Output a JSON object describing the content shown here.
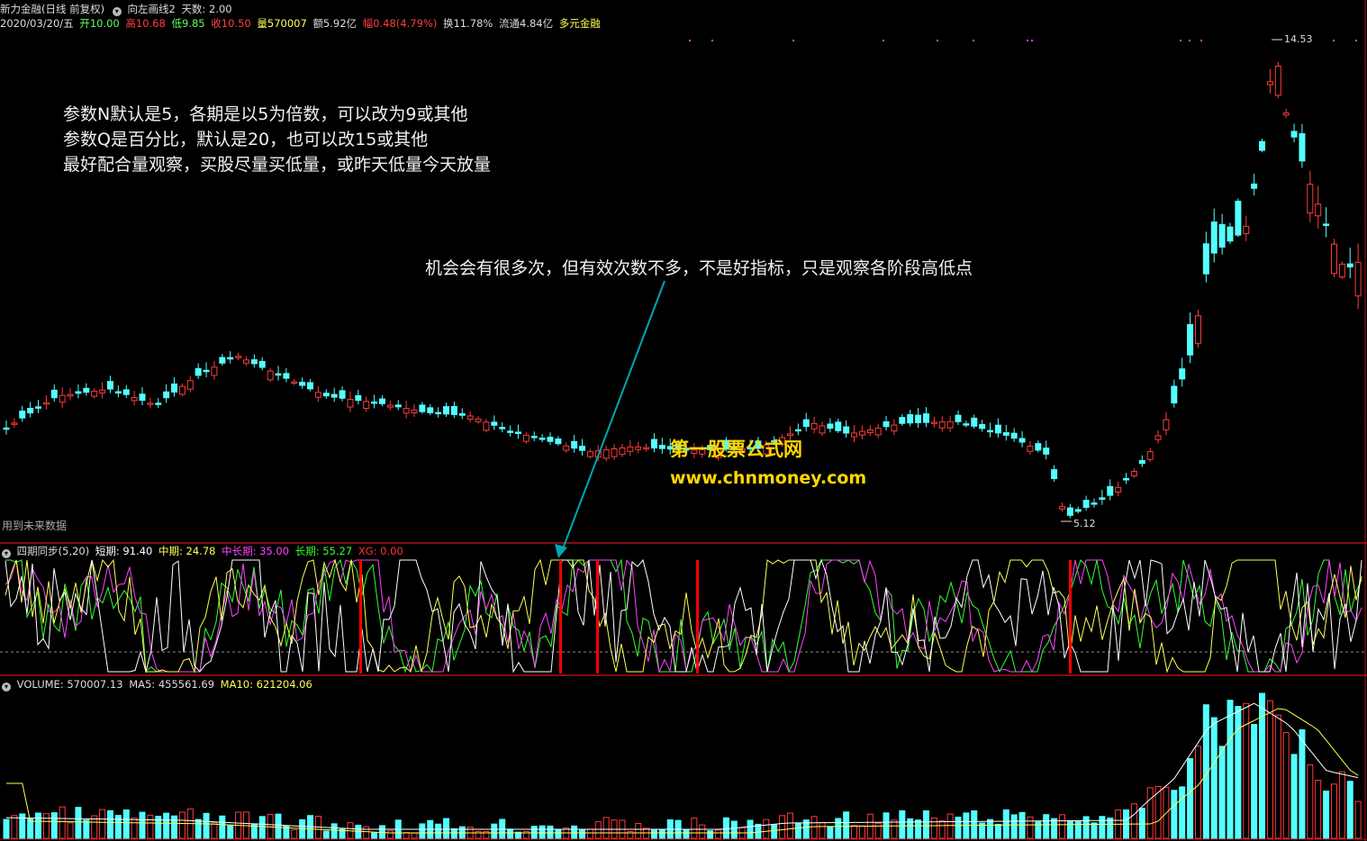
{
  "header": {
    "stock_name": "新力金融(日线 前复权)",
    "formula_name": "向左画线2",
    "days_label": "天数: 2.00"
  },
  "quote": {
    "date": "2020/03/20/五",
    "open": "开10.00",
    "high": "高10.68",
    "low": "低9.85",
    "close": "收10.50",
    "volume": "量570007",
    "amount": "额5.92亿",
    "change": "幅0.48(4.79%)",
    "turnover": "换11.78%",
    "float": "流通4.84亿",
    "sector": "多元金融"
  },
  "main_chart": {
    "high_marker": "14.53",
    "low_marker": "5.12",
    "future_data_note": "用到未来数据"
  },
  "annotations": {
    "lines": [
      "参数N默认是5，各期是以5为倍数，可以改为9或其他",
      "参数Q是百分比，默认是20，也可以改15或其他",
      "最好配合量观察，买股尽量买低量，或昨天低量今天放量"
    ],
    "arrow_note": "机会会有很多次，但有效次数不多，不是好指标，只是观察各阶段高低点",
    "watermark_name": "第一股票公式网",
    "watermark_url": "www.chnmoney.com"
  },
  "indicator": {
    "name": "四期同步(5,20)",
    "short": "短期: 91.40",
    "mid": "中期: 24.78",
    "midlong": "中长期: 35.00",
    "long": "长期: 55.27",
    "xg": "XG: 0.00"
  },
  "volume_panel": {
    "volume": "VOLUME: 570007.13",
    "ma5": "MA5: 455561.69",
    "ma10": "MA10: 621204.06"
  },
  "colors": {
    "up": "#ff3b3b",
    "down": "#54ffff",
    "short": "#ffffff",
    "mid": "#ffff55",
    "midlong": "#ff44ff",
    "long": "#33ff33",
    "signal": "#ff0000",
    "arrow": "#00a8b0",
    "panel_border": "#b01010"
  }
}
